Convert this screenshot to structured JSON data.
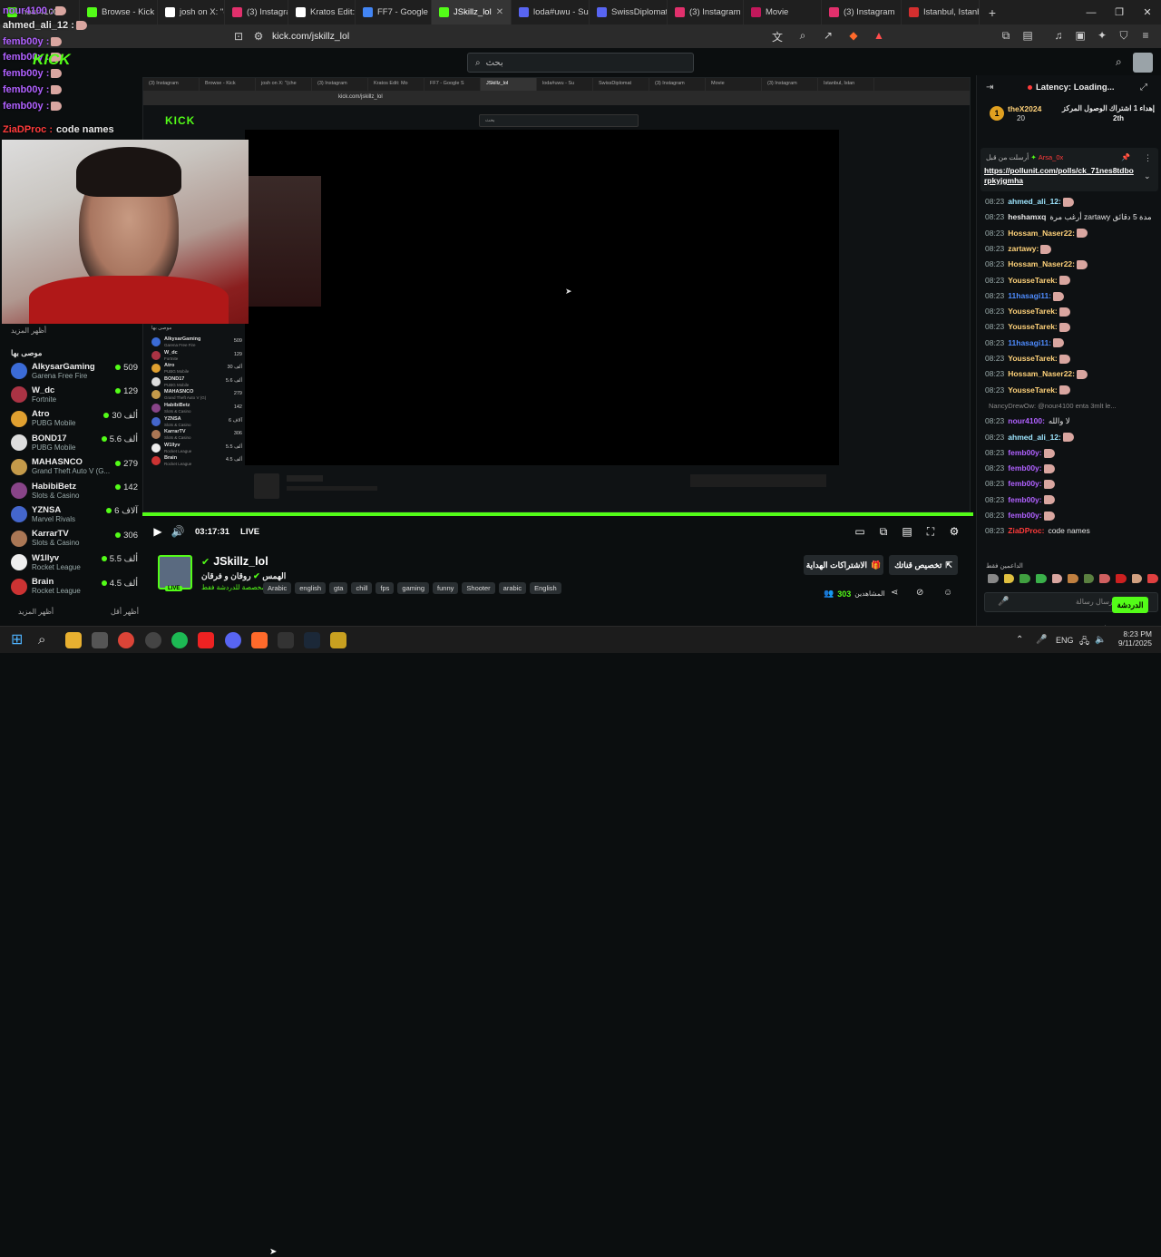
{
  "browser": {
    "tabs": [
      {
        "label": "nour4100",
        "color": "#53fc18"
      },
      {
        "label": "Browse - Kick",
        "color": "#53fc18"
      },
      {
        "label": "josh on X: \"(che",
        "color": "#ffffff"
      },
      {
        "label": "(3) Instagram",
        "color": "#e1306c"
      },
      {
        "label": "Kratos Edit: Mo",
        "color": "#ffffff"
      },
      {
        "label": "FF7 - Google S",
        "color": "#4285f4"
      },
      {
        "label": "JSkillz_lol",
        "color": "#53fc18",
        "active": true
      },
      {
        "label": "loda#uwu - Sur",
        "color": "#5865f2"
      },
      {
        "label": "SwissDiplomat",
        "color": "#5865f2"
      },
      {
        "label": "(3) Instagram",
        "color": "#e1306c"
      },
      {
        "label": "Movie",
        "color": "#c2185b"
      },
      {
        "label": "(3) Instagram",
        "color": "#e1306c"
      },
      {
        "label": "Istanbul, Istanb",
        "color": "#d32f2f"
      }
    ],
    "url": "kick.com/jskillz_lol",
    "search_placeholder": "بحث"
  },
  "overlay_chat": [
    {
      "user": "nour4100 :",
      "color": "#b061ff",
      "msg": ""
    },
    {
      "user": "ahmed_ali_12 :",
      "color": "#e8e8e8",
      "msg": ""
    },
    {
      "user": "femb00y :",
      "color": "#b061ff",
      "msg": ""
    },
    {
      "user": "femb00y :",
      "color": "#b061ff",
      "msg": ""
    },
    {
      "user": "femb00y :",
      "color": "#b061ff",
      "msg": ""
    },
    {
      "user": "femb00y :",
      "color": "#b061ff",
      "msg": ""
    },
    {
      "user": "femb00y :",
      "color": "#b061ff",
      "msg": ""
    },
    {
      "user": "ZiaDProc :",
      "color": "#ff3b3b",
      "msg": "code names"
    }
  ],
  "sidebar": {
    "show_more_top": "أظهر المزيد",
    "recommended": "موصى بها",
    "show_less": "أظهر أقل",
    "show_more_bottom": "أظهر المزيد",
    "items": [
      {
        "name": "AlkysarGaming",
        "game": "Garena Free Fire",
        "viewers": "509",
        "color": "#3b6bd6"
      },
      {
        "name": "W_dc",
        "game": "Fortnite",
        "viewers": "129",
        "color": "#aa3344"
      },
      {
        "name": "Atro",
        "game": "PUBG Mobile",
        "viewers": "30 ألف",
        "color": "#e0a030"
      },
      {
        "name": "BOND17",
        "game": "PUBG Mobile",
        "viewers": "5.6 ألف",
        "color": "#dddddd"
      },
      {
        "name": "MAHASNCO",
        "game": "Grand Theft Auto V (G...",
        "viewers": "279",
        "color": "#c49a4a"
      },
      {
        "name": "HabibiBetz",
        "game": "Slots & Casino",
        "viewers": "142",
        "color": "#884488"
      },
      {
        "name": "YZNSA",
        "game": "Marvel Rivals",
        "viewers": "6 آلاف",
        "color": "#4466cc"
      },
      {
        "name": "KarrarTV",
        "game": "Slots & Casino",
        "viewers": "306",
        "color": "#aa7755"
      },
      {
        "name": "W1llyv",
        "game": "Rocket League",
        "viewers": "5.5 ألف",
        "color": "#eeeeee"
      },
      {
        "name": "Brain",
        "game": "Rocket League",
        "viewers": "4.5 ألف",
        "color": "#cc3333"
      }
    ]
  },
  "share": {
    "url": "kick.com/jskillz_lol",
    "tabs": [
      "(3) Instagram",
      "Browse - Kick",
      "josh on X: \"(che",
      "(3) Instagram",
      "Kratos Edit: Mo",
      "FF7 - Google S",
      "JSkillz_lol",
      "loda#uwu - Su",
      "SwissDiplomat",
      "(3) Instagram",
      "Movie",
      "(3) Instagram",
      "Istanbul, Istan"
    ],
    "logo": "KICK",
    "items": [
      {
        "name": "AlkysarGaming",
        "game": "Garena Free Fire",
        "viewers": "509"
      },
      {
        "name": "W_dc",
        "game": "Fortnite",
        "viewers": "129"
      },
      {
        "name": "Atro",
        "game": "PUBG Mobile",
        "viewers": "30 ألف"
      },
      {
        "name": "BOND17",
        "game": "PUBG Mobile",
        "viewers": "5.6 ألف"
      },
      {
        "name": "MAHASNCO",
        "game": "Grand Theft Auto V (G)",
        "viewers": "279"
      },
      {
        "name": "HabibiBetz",
        "game": "Slots & Casino",
        "viewers": "142"
      },
      {
        "name": "YZNSA",
        "game": "Slots & Casino",
        "viewers": "6 آلاف"
      },
      {
        "name": "KarrarTV",
        "game": "Slots & Casino",
        "viewers": "306"
      },
      {
        "name": "W1llyv",
        "game": "Rocket League",
        "viewers": "5.5 ألف"
      },
      {
        "name": "Brain",
        "game": "Rocket League",
        "viewers": "4.5 ألف"
      }
    ]
  },
  "player": {
    "time": "03:17:31",
    "live": "LIVE",
    "progress_fraction": 1.0
  },
  "stream": {
    "name": "JSkillz_lol",
    "title": "روقان و فرقان",
    "category": "الهمس",
    "subtitle": "مخصصة للدردشة فقط",
    "live_badge": "LIVE",
    "tags": [
      "Arabic",
      "english",
      "gta",
      "chill",
      "fps",
      "gaming",
      "funny",
      "Shooter",
      "arabic",
      "English"
    ],
    "subscribe_label": "الاشتراكات الهداية",
    "customize_label": "تخصيص قناتك",
    "viewers_label": "المشاهدين",
    "viewers": "303"
  },
  "chat": {
    "latency": "Latency: Loading...",
    "gift_top_user": "theX2024",
    "gift_top_count": "20",
    "gift_top_text": "إهداء 1 اشتراك الوصول المركز",
    "gift_top_rank": "2th",
    "pinned_by": "أرسلت من قبل",
    "pinned_user": "Arsa_0x",
    "pinned_link": "https://pollunit.com/polls/ck_71nes8tdborpkyjgmha",
    "messages": [
      {
        "time": "08:23",
        "user": "ahmed_ali_12:",
        "color": "#9ee6ff",
        "text": ""
      },
      {
        "time": "08:23",
        "user": "heshamxq",
        "color": "#e8e8e8",
        "text": "أرغب مرة zartawy مدة 5 دقائق"
      },
      {
        "time": "08:23",
        "user": "Hossam_Naser22:",
        "color": "#ffd27a",
        "text": ""
      },
      {
        "time": "08:23",
        "user": "zartawy:",
        "color": "#ffd27a",
        "text": ""
      },
      {
        "time": "08:23",
        "user": "Hossam_Naser22:",
        "color": "#ffd27a",
        "text": ""
      },
      {
        "time": "08:23",
        "user": "YousseTarek:",
        "color": "#ffd27a",
        "text": ""
      },
      {
        "time": "08:23",
        "user": "11hasagi11:",
        "color": "#4e8cff",
        "text": ""
      },
      {
        "time": "08:23",
        "user": "YousseTarek:",
        "color": "#ffd27a",
        "text": ""
      },
      {
        "time": "08:23",
        "user": "YousseTarek:",
        "color": "#ffd27a",
        "text": ""
      },
      {
        "time": "08:23",
        "user": "11hasagi11:",
        "color": "#4e8cff",
        "text": ""
      },
      {
        "time": "08:23",
        "user": "YousseTarek:",
        "color": "#ffd27a",
        "text": ""
      },
      {
        "time": "08:23",
        "user": "Hossam_Naser22:",
        "color": "#ffd27a",
        "text": ""
      },
      {
        "time": "08:23",
        "user": "YousseTarek:",
        "color": "#ffd27a",
        "text": ""
      },
      {
        "time": "",
        "user": "",
        "color": "#888888",
        "text": "NancyDrewOw: @nour4100 enta 3mlt le..."
      },
      {
        "time": "08:23",
        "user": "nour4100:",
        "color": "#b061ff",
        "text": "لا والله"
      },
      {
        "time": "08:23",
        "user": "ahmed_ali_12:",
        "color": "#9ee6ff",
        "text": ""
      },
      {
        "time": "08:23",
        "user": "femb00y:",
        "color": "#b061ff",
        "text": ""
      },
      {
        "time": "08:23",
        "user": "femb00y:",
        "color": "#b061ff",
        "text": ""
      },
      {
        "time": "08:23",
        "user": "femb00y:",
        "color": "#b061ff",
        "text": ""
      },
      {
        "time": "08:23",
        "user": "femb00y:",
        "color": "#b061ff",
        "text": ""
      },
      {
        "time": "08:23",
        "user": "femb00y:",
        "color": "#b061ff",
        "text": ""
      },
      {
        "time": "08:23",
        "user": "ZiaDProc:",
        "color": "#ff3b3b",
        "text": "code names"
      }
    ],
    "supporters_label": "الداعمين فقط",
    "input_placeholder": "إرسال رسالة",
    "send_label": "الدردشة"
  },
  "taskbar": {
    "lang": "ENG",
    "time": "8:23 PM",
    "date": "9/11/2025"
  }
}
